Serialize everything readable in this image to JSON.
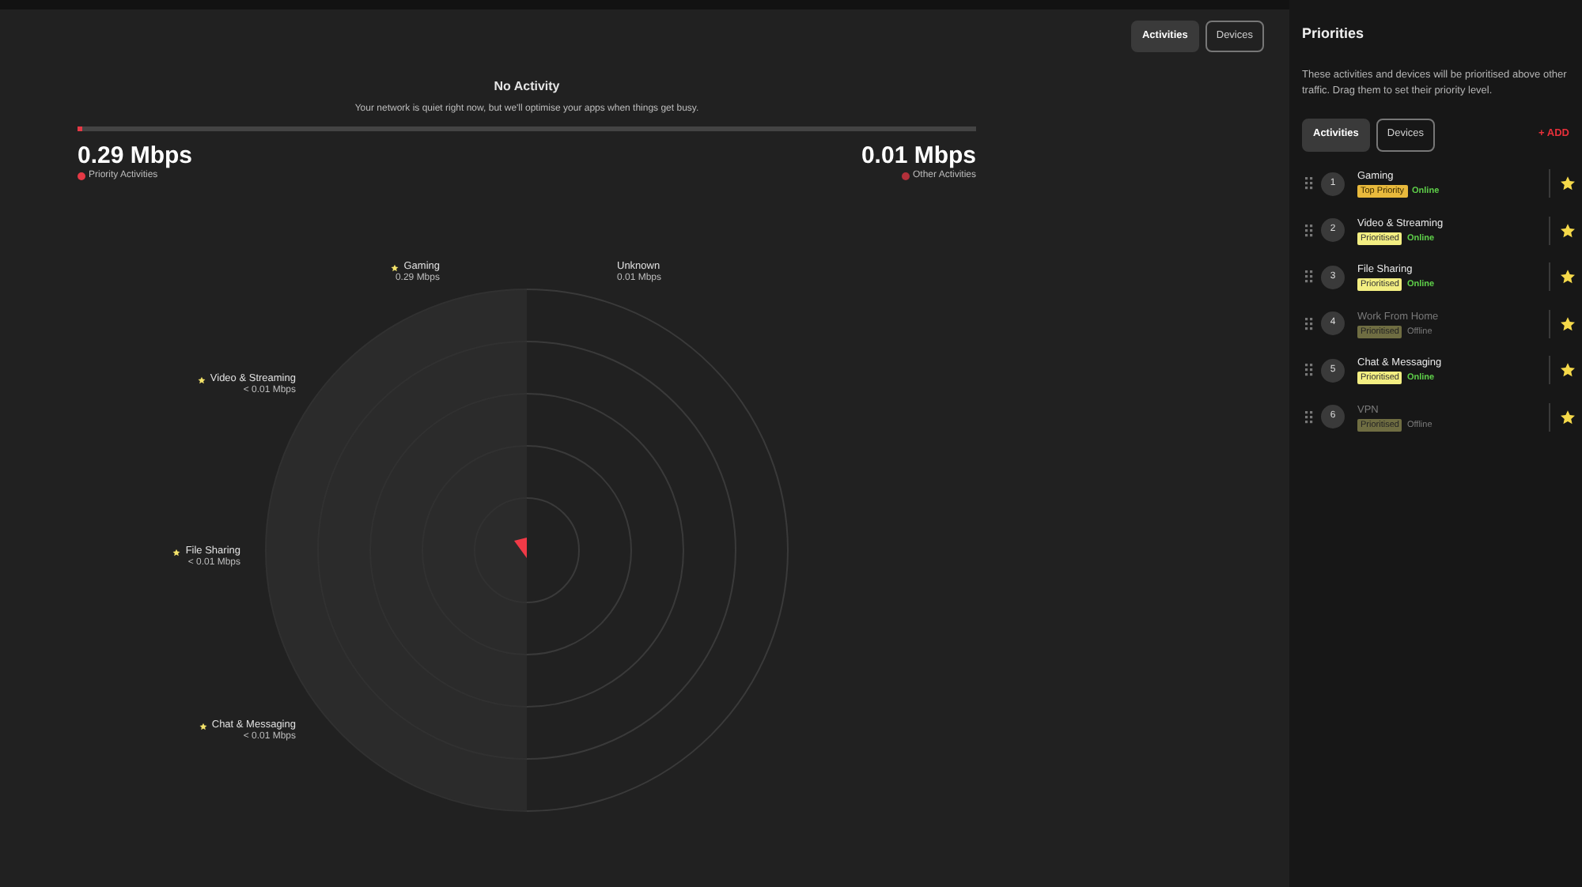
{
  "view_tabs": [
    {
      "label": "Activities",
      "selected": true
    },
    {
      "label": "Devices",
      "selected": false
    }
  ],
  "status": {
    "title": "No Activity",
    "message": "Your network is quiet right now, but we'll optimise your apps when things get busy.",
    "level": 0.005
  },
  "totals": [
    {
      "value": "0.29 Mbps",
      "label": "Priority Activities",
      "color": "#e53945"
    },
    {
      "value": "0.01 Mbps",
      "label": "Other Activities",
      "color": "#b3303a"
    }
  ],
  "radar": {
    "segments": [
      {
        "name": "Gaming",
        "rate": "0.29 Mbps",
        "starred": true
      },
      {
        "name": "Unknown",
        "rate": "0.01 Mbps",
        "starred": false
      },
      {
        "name": "Video & Streaming",
        "rate": "< 0.01 Mbps",
        "starred": true
      },
      {
        "name": "File Sharing",
        "rate": "< 0.01 Mbps",
        "starred": true
      },
      {
        "name": "Chat & Messaging",
        "rate": "< 0.01 Mbps",
        "starred": true
      }
    ]
  },
  "sidebar": {
    "title": "Priorities",
    "description": "These activities and devices will be prioritised above other traffic. Drag them to set their priority level.",
    "tabs": [
      {
        "label": "Activities",
        "selected": true
      },
      {
        "label": "Devices",
        "selected": false
      }
    ],
    "add_label": "+ ADD",
    "items": [
      {
        "number": "1",
        "name": "Gaming",
        "badge": "Top Priority",
        "kind": "top",
        "status": "Online",
        "online": true
      },
      {
        "number": "2",
        "name": "Video & Streaming",
        "badge": "Prioritised",
        "kind": "prioritised",
        "status": "Online",
        "online": true
      },
      {
        "number": "3",
        "name": "File Sharing",
        "badge": "Prioritised",
        "kind": "prioritised",
        "status": "Online",
        "online": true
      },
      {
        "number": "4",
        "name": "Work From Home",
        "badge": "Prioritised",
        "kind": "prioritised",
        "status": "Offline",
        "online": false
      },
      {
        "number": "5",
        "name": "Chat & Messaging",
        "badge": "Prioritised",
        "kind": "prioritised",
        "status": "Online",
        "online": true
      },
      {
        "number": "6",
        "name": "VPN",
        "badge": "Prioritised",
        "kind": "prioritised",
        "status": "Offline",
        "online": false
      }
    ]
  }
}
